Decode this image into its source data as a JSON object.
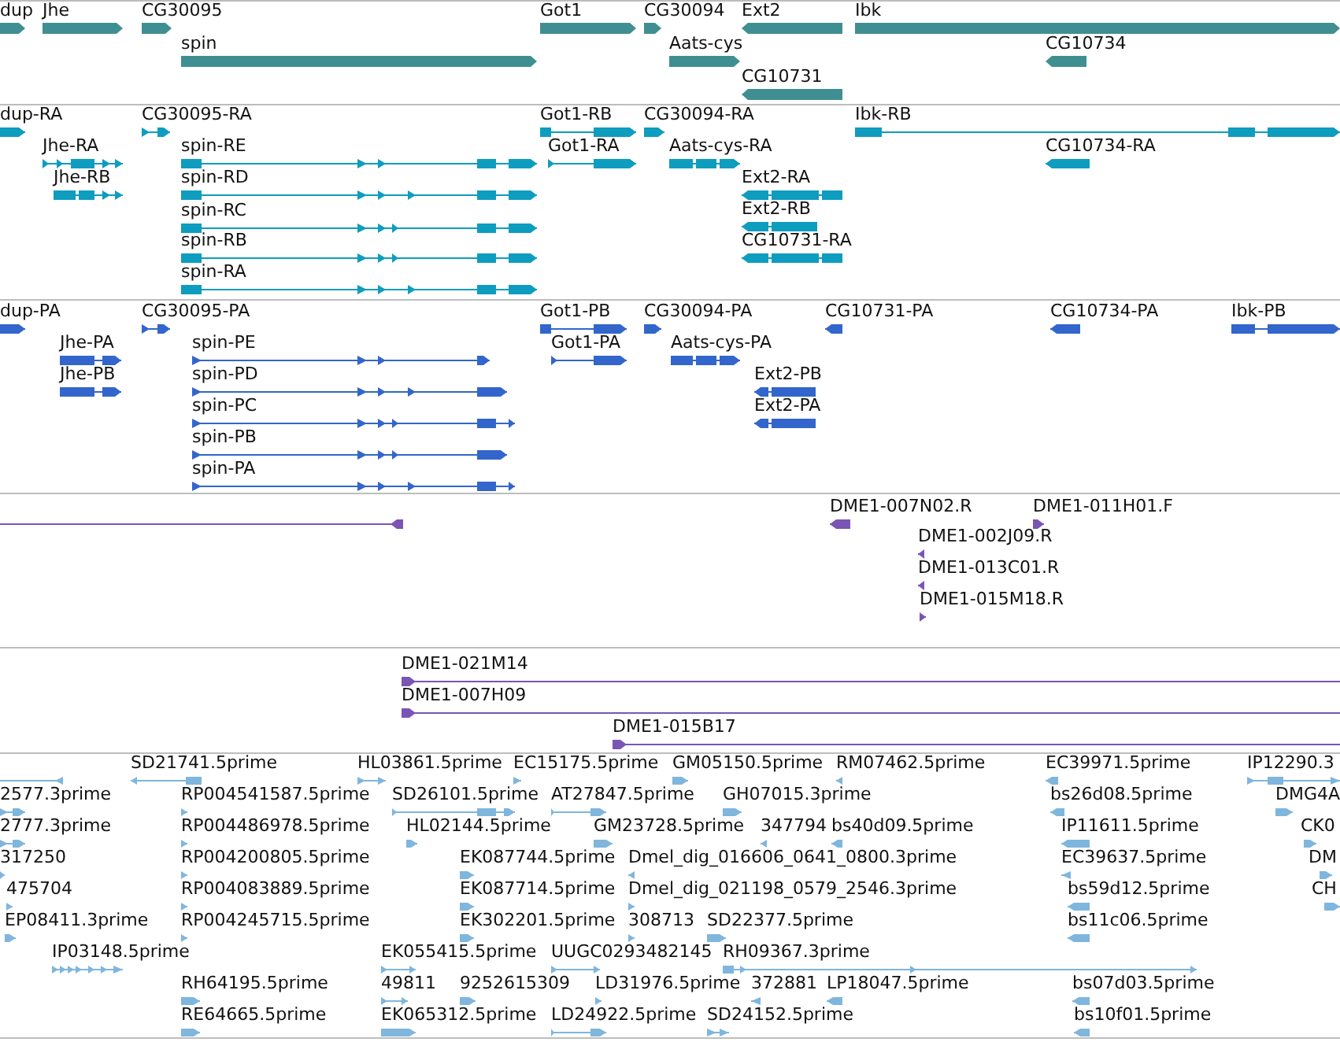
{
  "tracks": [
    {
      "kind": "gene",
      "features": [
        {
          "label": "dup",
          "reverse": false
        },
        {
          "label": "Jhe",
          "reverse": false
        },
        {
          "label": "CG30095",
          "reverse": false
        },
        {
          "label": "spin",
          "reverse": false
        },
        {
          "label": "Got1",
          "reverse": false
        },
        {
          "label": "CG30094",
          "reverse": false
        },
        {
          "label": "Ext2",
          "reverse": true
        },
        {
          "label": "Ibk",
          "reverse": false
        },
        {
          "label": "Aats-cys",
          "reverse": false
        },
        {
          "label": "CG10734",
          "reverse": true
        },
        {
          "label": "CG10731",
          "reverse": true
        }
      ]
    },
    {
      "kind": "mrna",
      "features": [
        {
          "label": "dup-RA",
          "reverse": false
        },
        {
          "label": "CG30095-RA",
          "reverse": false
        },
        {
          "label": "Jhe-RA",
          "reverse": false
        },
        {
          "label": "Jhe-RB",
          "reverse": false
        },
        {
          "label": "spin-RE",
          "reverse": false
        },
        {
          "label": "spin-RD",
          "reverse": false
        },
        {
          "label": "spin-RC",
          "reverse": false
        },
        {
          "label": "spin-RB",
          "reverse": false
        },
        {
          "label": "spin-RA",
          "reverse": false
        },
        {
          "label": "Got1-RB",
          "reverse": false
        },
        {
          "label": "Got1-RA",
          "reverse": false
        },
        {
          "label": "CG30094-RA",
          "reverse": false
        },
        {
          "label": "Aats-cys-RA",
          "reverse": false
        },
        {
          "label": "Ext2-RA",
          "reverse": true
        },
        {
          "label": "Ext2-RB",
          "reverse": true
        },
        {
          "label": "CG10731-RA",
          "reverse": true
        },
        {
          "label": "Ibk-RB",
          "reverse": false
        },
        {
          "label": "CG10734-RA",
          "reverse": true
        }
      ]
    },
    {
      "kind": "protein",
      "features": [
        {
          "label": "dup-PA",
          "reverse": false
        },
        {
          "label": "CG30095-PA",
          "reverse": false
        },
        {
          "label": "Jhe-PA",
          "reverse": false
        },
        {
          "label": "Jhe-PB",
          "reverse": false
        },
        {
          "label": "spin-PE",
          "reverse": false
        },
        {
          "label": "spin-PD",
          "reverse": false
        },
        {
          "label": "spin-PC",
          "reverse": false
        },
        {
          "label": "spin-PB",
          "reverse": false
        },
        {
          "label": "spin-PA",
          "reverse": false
        },
        {
          "label": "Got1-PB",
          "reverse": false
        },
        {
          "label": "Got1-PA",
          "reverse": false
        },
        {
          "label": "CG30094-PA",
          "reverse": false
        },
        {
          "label": "Aats-cys-PA",
          "reverse": false
        },
        {
          "label": "Ext2-PB",
          "reverse": true
        },
        {
          "label": "Ext2-PA",
          "reverse": true
        },
        {
          "label": "CG10731-PA",
          "reverse": true
        },
        {
          "label": "CG10734-PA",
          "reverse": true
        },
        {
          "label": "Ibk-PB",
          "reverse": false
        }
      ]
    },
    {
      "kind": "bac_end",
      "features": [
        {
          "reverse": true
        },
        {
          "label": "DME1-007N02.R",
          "reverse": true
        },
        {
          "label": "DME1-011H01.F",
          "reverse": false
        },
        {
          "label": "DME1-002J09.R",
          "reverse": true
        },
        {
          "label": "DME1-013C01.R",
          "reverse": true
        },
        {
          "label": "DME1-015M18.R",
          "reverse": false
        }
      ]
    },
    {
      "kind": "bac_clone",
      "features": [
        {
          "label": "DME1-021M14",
          "reverse": false
        },
        {
          "label": "DME1-007H09",
          "reverse": false
        },
        {
          "label": "DME1-015B17",
          "reverse": false
        }
      ]
    },
    {
      "kind": "est",
      "features": [
        {
          "reverse": true
        },
        {
          "label": "SD21741.5prime",
          "reverse": true
        },
        {
          "label": "HL03861.5prime",
          "reverse": false
        },
        {
          "label": "EC15175.5prime",
          "reverse": false
        },
        {
          "label": "GM05150.5prime",
          "reverse": false
        },
        {
          "label": "RM07462.5prime",
          "reverse": true
        },
        {
          "label": "EC39971.5prime",
          "reverse": true
        },
        {
          "label": "IP12290.3",
          "reverse": false
        },
        {
          "label": "2577.3prime",
          "reverse": false
        },
        {
          "label": "RP004541587.5prime",
          "reverse": false
        },
        {
          "label": "SD26101.5prime",
          "reverse": false
        },
        {
          "label": "AT27847.5prime",
          "reverse": false
        },
        {
          "label": "GH07015.3prime",
          "reverse": false
        },
        {
          "label": "bs26d08.5prime",
          "reverse": true
        },
        {
          "label": "DMG4A",
          "reverse": false
        },
        {
          "label": "2777.3prime",
          "reverse": false
        },
        {
          "label": "RP004486978.5prime",
          "reverse": false
        },
        {
          "label": "HL02144.5prime",
          "reverse": false
        },
        {
          "label": "GM23728.5prime",
          "reverse": false
        },
        {
          "label": "347794",
          "reverse": true
        },
        {
          "label": "bs40d09.5prime",
          "reverse": true
        },
        {
          "label": "IP11611.5prime",
          "reverse": true
        },
        {
          "label": "CK0",
          "reverse": false
        },
        {
          "label": "317250",
          "reverse": false
        },
        {
          "label": "RP004200805.5prime",
          "reverse": false
        },
        {
          "label": "EK087744.5prime",
          "reverse": false
        },
        {
          "label": "Dmel_dig_016606_0641_0800.3prime",
          "reverse": true
        },
        {
          "label": "EC39637.5prime",
          "reverse": true
        },
        {
          "label": "DM",
          "reverse": false
        },
        {
          "label": "475704",
          "reverse": false
        },
        {
          "label": "RP004083889.5prime",
          "reverse": false
        },
        {
          "label": "EK087714.5prime",
          "reverse": false
        },
        {
          "label": "Dmel_dig_021198_0579_2546.3prime",
          "reverse": false
        },
        {
          "label": "bs59d12.5prime",
          "reverse": true
        },
        {
          "label": "CH",
          "reverse": false
        },
        {
          "label": "EP08411.3prime",
          "reverse": false
        },
        {
          "label": "RP004245715.5prime",
          "reverse": false
        },
        {
          "label": "EK302201.5prime",
          "reverse": false
        },
        {
          "label": "308713",
          "reverse": false
        },
        {
          "label": "SD22377.5prime",
          "reverse": false
        },
        {
          "label": "bs11c06.5prime",
          "reverse": true
        },
        {
          "label": "IP03148.5prime",
          "reverse": false
        },
        {
          "label": "EK055415.5prime",
          "reverse": false
        },
        {
          "label": "UUGC0293482145",
          "reverse": false
        },
        {
          "label": "RH09367.3prime",
          "reverse": false
        },
        {
          "label": "RH64195.5prime",
          "reverse": false
        },
        {
          "label": "49811",
          "reverse": false
        },
        {
          "label": "9252615309",
          "reverse": false
        },
        {
          "label": "LD31976.5prime",
          "reverse": false
        },
        {
          "label": "372881",
          "reverse": true
        },
        {
          "label": "LP18047.5prime",
          "reverse": true
        },
        {
          "label": "bs07d03.5prime",
          "reverse": true
        },
        {
          "label": "RE64665.5prime",
          "reverse": false
        },
        {
          "label": "EK065312.5prime",
          "reverse": false
        },
        {
          "label": "LD24922.5prime",
          "reverse": false
        },
        {
          "label": "SD24152.5prime",
          "reverse": false
        },
        {
          "label": "bs10f01.5prime",
          "reverse": true
        }
      ]
    }
  ]
}
